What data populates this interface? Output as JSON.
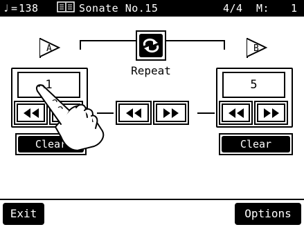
{
  "header": {
    "note_glyph": "♩",
    "tempo_eq": "=",
    "tempo": "138",
    "book_icon": "book-icon",
    "song_title": "Sonate No.15",
    "time_signature": "4/4",
    "measure_label": "M:",
    "measure": "1"
  },
  "marker_a": {
    "label": "A",
    "value": "1",
    "rewind_icon": "rewind-icon",
    "forward_icon": "fast-forward-icon",
    "clear_label": "Clear"
  },
  "marker_b": {
    "label": "B",
    "value": "5",
    "rewind_icon": "rewind-icon",
    "forward_icon": "fast-forward-icon",
    "clear_label": "Clear"
  },
  "repeat": {
    "icon": "repeat-loop-icon",
    "label": "Repeat"
  },
  "center_controls": {
    "rewind_icon": "rewind-icon",
    "forward_icon": "fast-forward-icon"
  },
  "footer": {
    "exit_label": "Exit",
    "options_label": "Options"
  },
  "colors": {
    "foreground": "#000000",
    "background": "#ffffff",
    "inverse_text": "#ffffff"
  },
  "overlay": {
    "icon": "pointing-hand-icon"
  }
}
